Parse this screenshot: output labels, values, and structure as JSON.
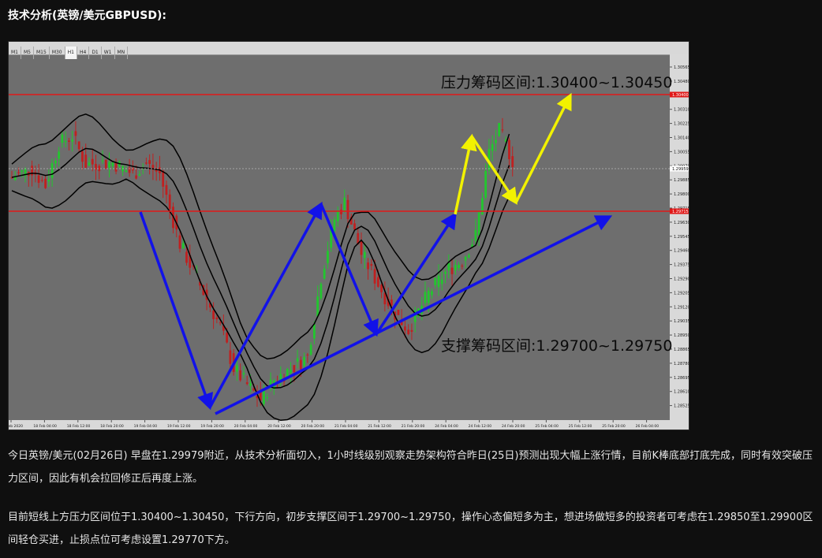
{
  "article": {
    "title": "技术分析(英镑/美元GBPUSD):",
    "paragraph1": "今日英镑/美元(02月26日) 早盘在1.29979附近，从技术分析面切入，1小时线级别观察走势架构符合昨日(25日)预测出现大幅上涨行情，目前K棒底部打底完成，同时有效突破压力区间，因此有机会拉回修正后再度上涨。",
    "paragraph2": "目前短线上方压力区间位于1.30400~1.30450，下行方向，初步支撑区间于1.29700~1.29750，操作心态偏短多为主，想进场做短多的投资者可考虑在1.29850至1.29900区间轻仓买进，止损点位可考虑设置1.29770下方。"
  },
  "chart_data": {
    "type": "candlestick",
    "symbol": "GBPUSD",
    "timeframe": "H1",
    "timeframes": [
      "M1",
      "M5",
      "M15",
      "M30",
      "H1",
      "H4",
      "D1",
      "W1",
      "MN"
    ],
    "y_ticks": [
      "1.30565",
      "1.30480",
      "1.30395",
      "1.30310",
      "1.30225",
      "1.30140",
      "1.30055",
      "1.29970",
      "1.29885",
      "1.29800",
      "1.29715",
      "1.29630",
      "1.29545",
      "1.29460",
      "1.29375",
      "1.29290",
      "1.29205",
      "1.29120",
      "1.29035",
      "1.28950",
      "1.28865",
      "1.28780",
      "1.28695",
      "1.28610",
      "1.28525",
      "1.28440"
    ],
    "x_ticks": [
      "18 Feb 2020",
      "18 Feb 04:00",
      "18 Feb 12:00",
      "18 Feb 20:00",
      "19 Feb 04:00",
      "19 Feb 12:00",
      "19 Feb 20:00",
      "20 Feb 04:00",
      "20 Feb 12:00",
      "20 Feb 20:00",
      "21 Feb 04:00",
      "21 Feb 12:00",
      "21 Feb 20:00",
      "24 Feb 04:00",
      "24 Feb 12:00",
      "24 Feb 20:00",
      "25 Feb 04:00",
      "25 Feb 12:00",
      "25 Feb 20:00",
      "26 Feb 04:00"
    ],
    "ylim": [
      1.2844,
      1.306
    ],
    "current_price": "1.29959",
    "resistance_price": "1.30400",
    "support_line_price": "1.29715",
    "annotations": {
      "resistance_label": "压力筹码区间:1.30400~1.30450",
      "support_label": "支撑筹码区间:1.29700~1.29750"
    },
    "colors": {
      "background": "#6e6e6e",
      "up_candle": "#22c62e",
      "down_candle": "#c02020",
      "bands": "#000000",
      "horizontal_levels": "#e01818",
      "path_arrows": "#1212e8",
      "projection_arrows": "#f2f200"
    }
  }
}
